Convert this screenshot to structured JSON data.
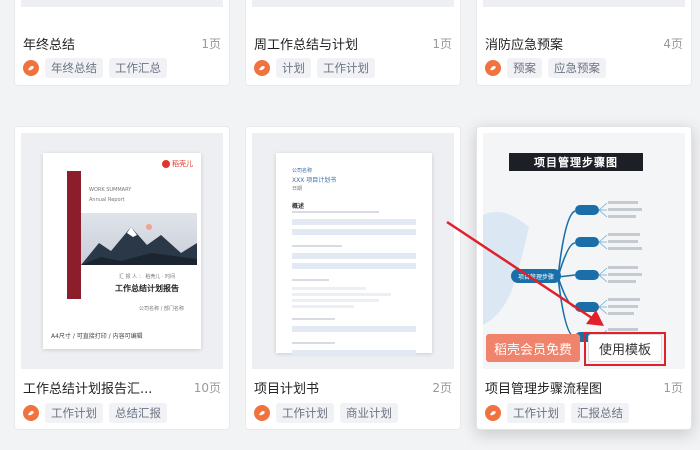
{
  "top_cards": [
    {
      "title": "年终总结",
      "pages": "1页",
      "tags": [
        "年终总结",
        "工作汇总"
      ]
    },
    {
      "title": "周工作总结与计划",
      "pages": "1页",
      "tags": [
        "计划",
        "工作计划"
      ]
    },
    {
      "title": "消防应急预案",
      "pages": "4页",
      "tags": [
        "预案",
        "应急预案"
      ]
    }
  ],
  "bottom_cards": [
    {
      "title": "工作总结计划报告汇...",
      "pages": "10页",
      "tags": [
        "工作计划",
        "总结汇报"
      ]
    },
    {
      "title": "项目计划书",
      "pages": "2页",
      "tags": [
        "工作计划",
        "商业计划"
      ]
    },
    {
      "title": "项目管理步骤流程图",
      "pages": "1页",
      "tags": [
        "工作计划",
        "汇报总结"
      ]
    }
  ],
  "cover1": {
    "brand": "稻壳儿",
    "subtitle_en": "WORK SUMMARY",
    "subtitle2": "Annual Report",
    "meta": "汇 报 人 ： 稻壳儿 · 时间",
    "title": "工作总结计划报告",
    "company": "公司名称 / 部门名称",
    "footer": "A4尺寸 / 可直接打印 / 内容可编辑"
  },
  "cover2": {
    "company": "公司名称",
    "title": "XXX 项目计划书",
    "date": "日期",
    "toc": "概述",
    "items": [
      "项目背景与目标",
      "团队组成",
      "风险控制",
      "任务与计划",
      "资源管理"
    ]
  },
  "cover3": {
    "title": "项目管理步骤图",
    "center": "项目管理步骤",
    "node_count": 5
  },
  "overlay": {
    "vip_label": "稻壳会员免费",
    "use_label": "使用模板"
  },
  "colors": {
    "accent": "#f0733f",
    "vip": "#f0836b",
    "highlight": "#e0202a",
    "mind_blue": "#1a6fa8"
  }
}
